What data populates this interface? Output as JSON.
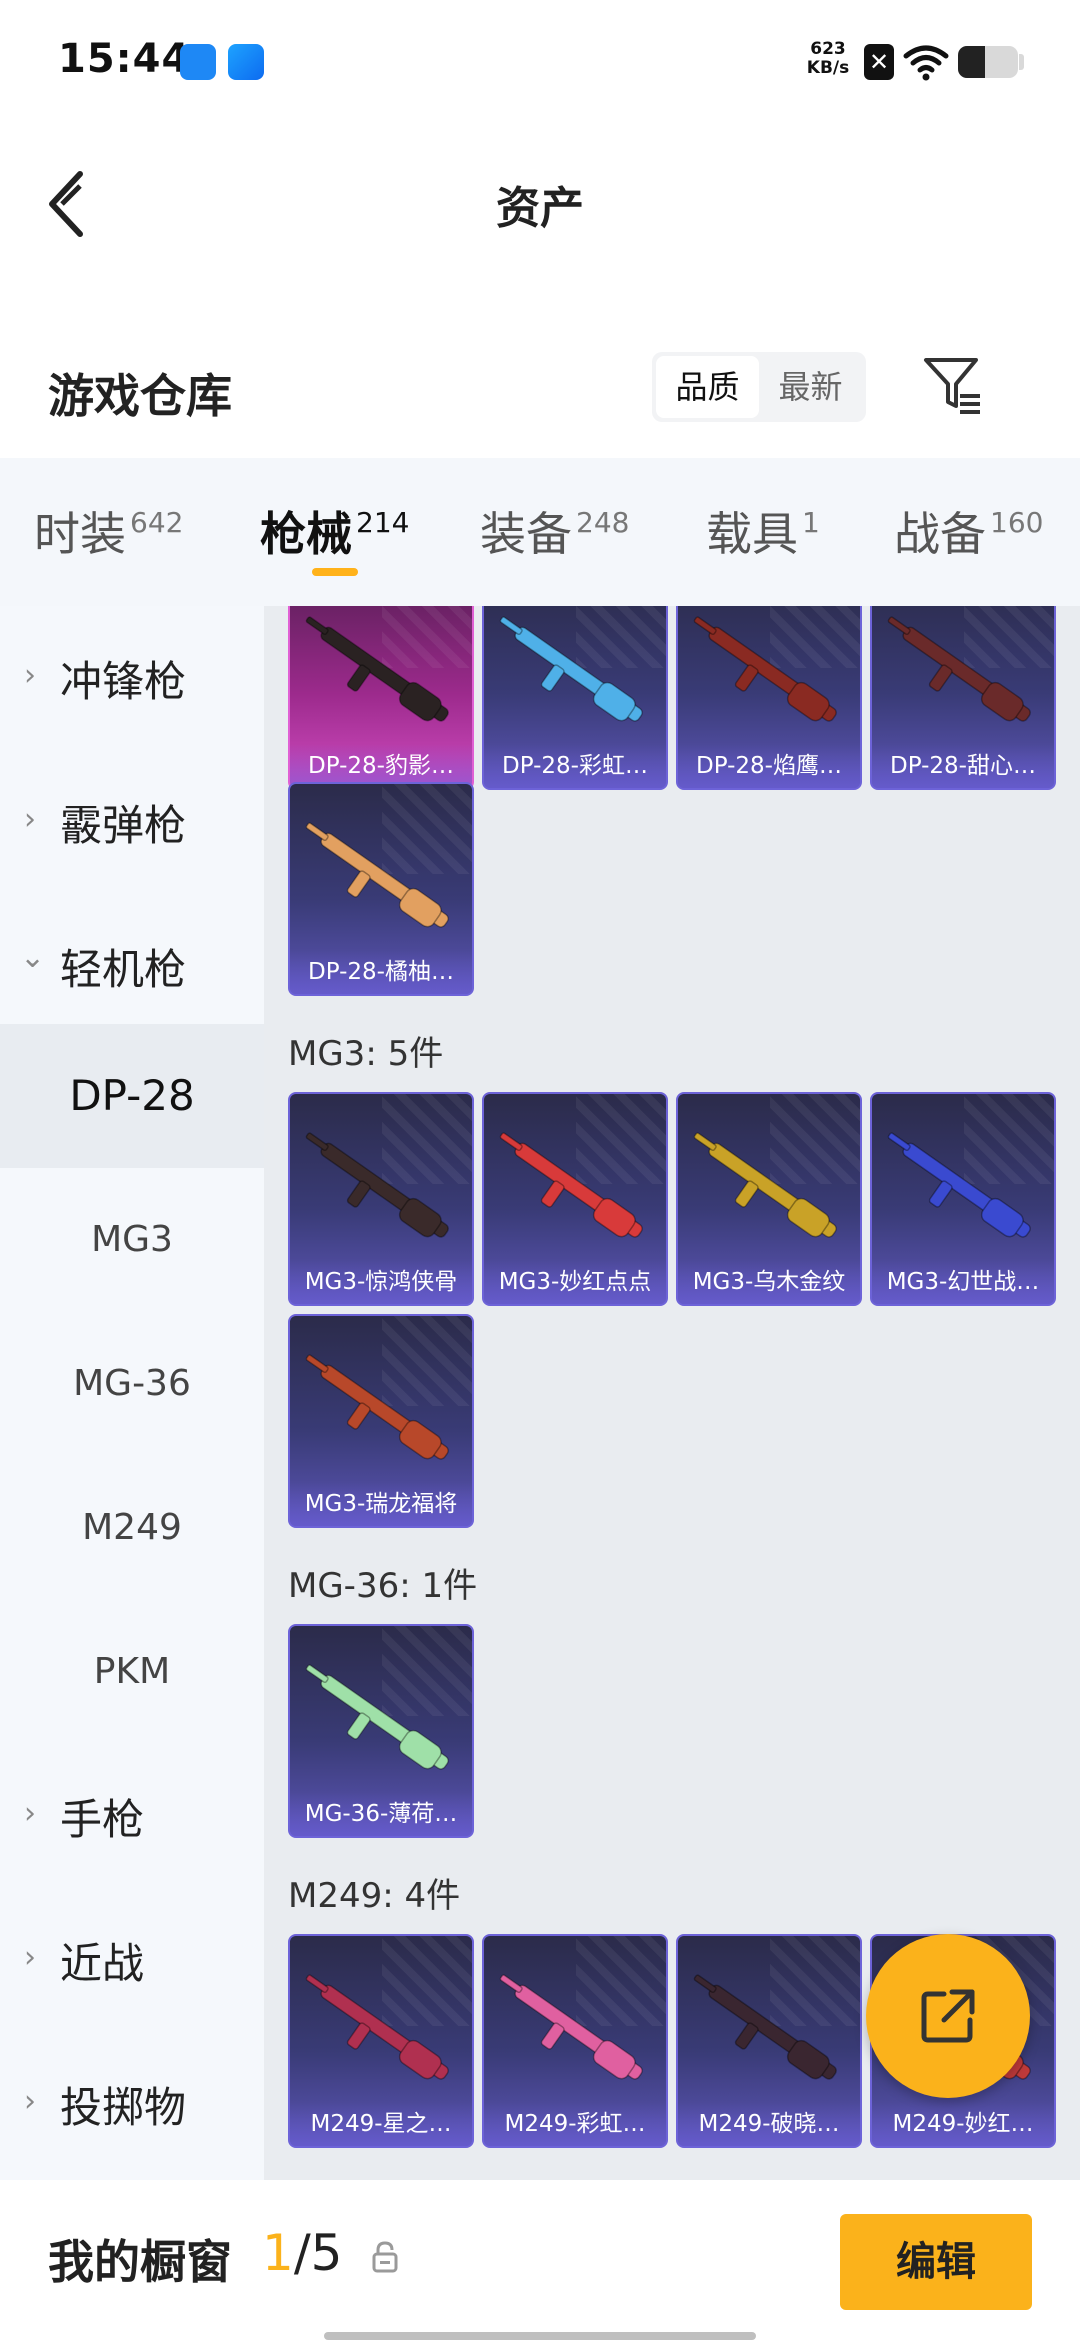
{
  "status_bar": {
    "time": "15:44",
    "net_speed_value": "623",
    "net_speed_unit": "KB/s",
    "battery_level": 0.45,
    "icons": [
      "gallery-app-icon",
      "browser-app-icon",
      "x-app-icon",
      "wifi-icon",
      "battery-icon"
    ]
  },
  "nav": {
    "title": "资产",
    "back_icon": "back-arrow-icon"
  },
  "warehouse": {
    "title": "游戏仓库",
    "sort_options": [
      "品质",
      "最新"
    ],
    "sort_selected": "品质",
    "filter_icon": "filter-icon"
  },
  "tabs": [
    {
      "label": "时装",
      "count": "642"
    },
    {
      "label": "枪械",
      "count": "214",
      "active": true
    },
    {
      "label": "装备",
      "count": "248"
    },
    {
      "label": "载具",
      "count": "1"
    },
    {
      "label": "战备",
      "count": "160"
    }
  ],
  "sidebar": {
    "categories": [
      {
        "label": "冲锋枪",
        "expanded": false
      },
      {
        "label": "霰弹枪",
        "expanded": false
      },
      {
        "label": "轻机枪",
        "expanded": true
      },
      {
        "label": "手枪",
        "expanded": false
      },
      {
        "label": "近战",
        "expanded": false
      },
      {
        "label": "投掷物",
        "expanded": false
      }
    ],
    "subcategories": [
      {
        "label": "DP-28",
        "active": true
      },
      {
        "label": "MG3"
      },
      {
        "label": "MG-36"
      },
      {
        "label": "M249"
      },
      {
        "label": "PKM"
      }
    ]
  },
  "groups": {
    "dp28": {
      "items": [
        "DP-28-豹影…",
        "DP-28-彩虹…",
        "DP-28-焰鹰…",
        "DP-28-甜心…",
        "DP-28-橘柚…"
      ]
    },
    "mg3": {
      "title": "MG3: 5件",
      "items": [
        "MG3-惊鸿侠骨",
        "MG3-妙红点点",
        "MG3-乌木金纹",
        "MG3-幻世战…",
        "MG3-瑞龙福将"
      ]
    },
    "mg36": {
      "title": "MG-36: 1件",
      "items": [
        "MG-36-薄荷…"
      ]
    },
    "m249": {
      "title": "M249: 4件",
      "items": [
        "M249-星之…",
        "M249-彩虹…",
        "M249-破晓…",
        "M249-妙红…"
      ]
    }
  },
  "fab": {
    "icon": "share-external-icon"
  },
  "bottom": {
    "showcase_label": "我的橱窗",
    "showcase_current": "1",
    "showcase_total": "/5",
    "lock_icon": "lock-icon",
    "edit_label": "编辑"
  }
}
